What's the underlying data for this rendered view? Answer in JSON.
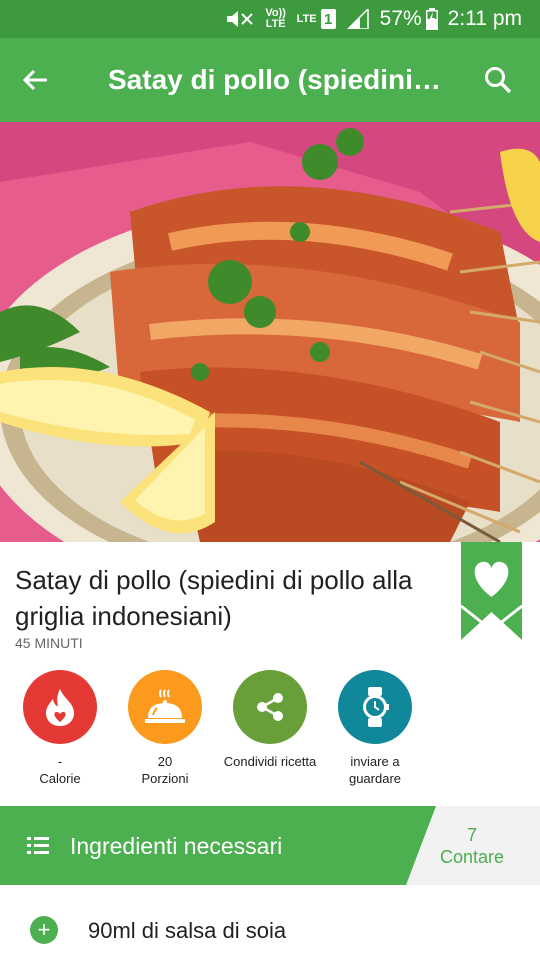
{
  "status_bar": {
    "volte": "Vo)) LTE",
    "lte": "LTE",
    "sim": "1",
    "battery": "57%",
    "time": "2:11 pm"
  },
  "app_bar": {
    "title": "Satay di pollo (spiedini…"
  },
  "recipe": {
    "title": "Satay di pollo (spiedini di pollo alla griglia indonesiani)",
    "time": "45 MINUTI",
    "bookmarked": true
  },
  "actions": [
    {
      "value": "-",
      "label": "Calorie",
      "color": "#e53935",
      "icon": "calorie-flame-icon"
    },
    {
      "value": "20",
      "label": "Porzioni",
      "color": "#fb9a1c",
      "icon": "serving-dish-icon"
    },
    {
      "value": "",
      "label": "Condividi ricetta",
      "color": "#689f38",
      "icon": "share-icon"
    },
    {
      "value": "",
      "label": "inviare a guardare",
      "color": "#11879a",
      "icon": "watch-icon"
    }
  ],
  "ingredients_section": {
    "label": "Ingredienti necessari",
    "count": "7",
    "count_label": "Contare"
  },
  "ingredients": [
    {
      "text": "90ml di salsa di soia"
    }
  ],
  "colors": {
    "primary": "#4caf50",
    "status_bar": "#3d9a3f"
  }
}
